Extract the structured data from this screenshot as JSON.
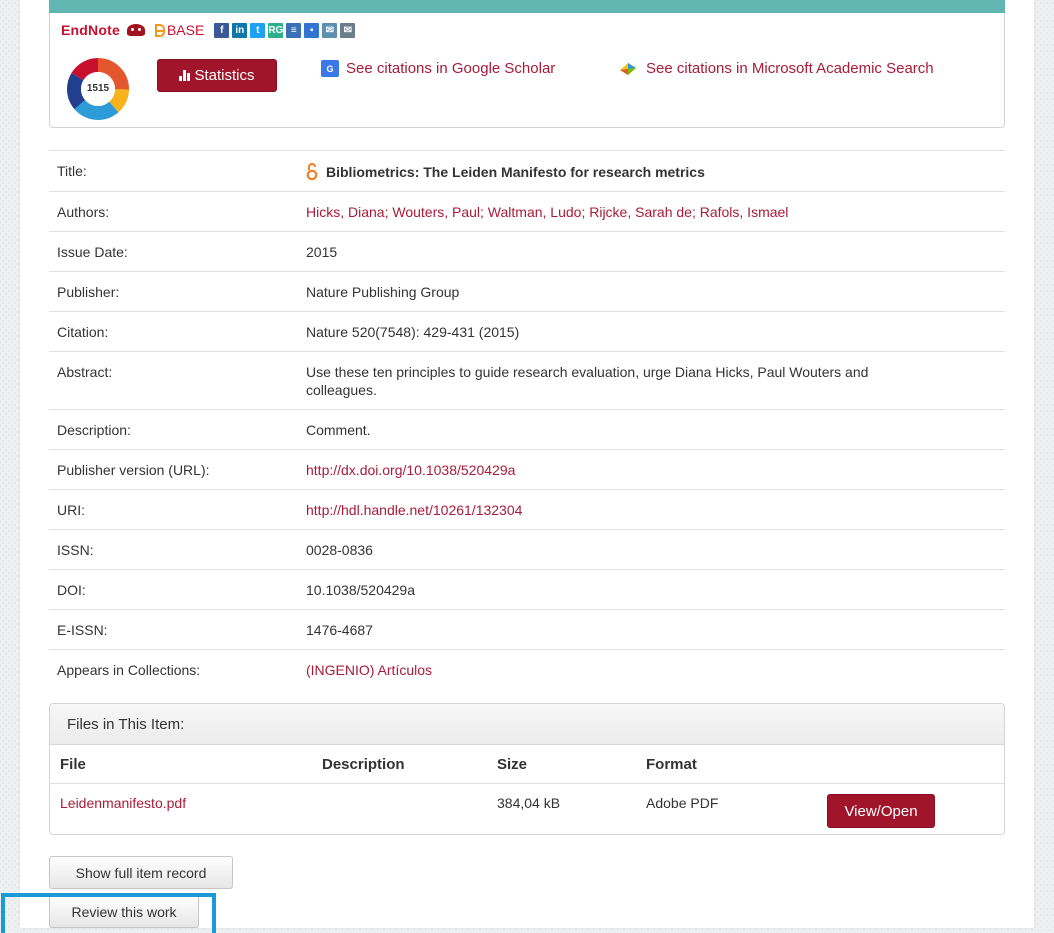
{
  "share": {
    "endnote_label": "EndNote",
    "base_label": "BASE",
    "icons": [
      {
        "name": "facebook-icon",
        "glyph": "f",
        "color": "#3b5998"
      },
      {
        "name": "linkedin-icon",
        "glyph": "in",
        "color": "#0e76a8"
      },
      {
        "name": "twitter-icon",
        "glyph": "t",
        "color": "#1da1f2"
      },
      {
        "name": "researchgate-icon",
        "glyph": "RG",
        "color": "#2ab08d"
      },
      {
        "name": "list-icon",
        "glyph": "≡",
        "color": "#3b6fb6"
      },
      {
        "name": "delicious-icon",
        "glyph": "▪",
        "color": "#3274d0"
      },
      {
        "name": "chat-icon",
        "glyph": "✉",
        "color": "#5d8fb1"
      },
      {
        "name": "email-icon",
        "glyph": "✉",
        "color": "#6a7d8c"
      }
    ]
  },
  "metrics": {
    "altmetric_score": "1515",
    "statistics_label": "Statistics",
    "google_scholar_label": "See citations in Google Scholar",
    "microsoft_label": "See citations in Microsoft Academic Search"
  },
  "record": [
    {
      "label": "Title:",
      "value": "Bibliometrics: The Leiden Manifesto for research metrics",
      "kind": "title"
    },
    {
      "label": "Authors:",
      "value": "Hicks, Diana; Wouters, Paul; Waltman, Ludo; Rijcke, Sarah de; Rafols, Ismael",
      "kind": "link"
    },
    {
      "label": "Issue Date:",
      "value": "2015",
      "kind": "text"
    },
    {
      "label": "Publisher:",
      "value": "Nature Publishing Group",
      "kind": "text"
    },
    {
      "label": "Citation:",
      "value": "Nature 520(7548): 429-431 (2015)",
      "kind": "text"
    },
    {
      "label": "Abstract:",
      "value": "Use these ten principles to guide research evaluation, urge Diana Hicks, Paul Wouters and colleagues.",
      "kind": "text"
    },
    {
      "label": "Description:",
      "value": "Comment.",
      "kind": "text"
    },
    {
      "label": "Publisher version (URL):",
      "value": "http://dx.doi.org/10.1038/520429a",
      "kind": "link"
    },
    {
      "label": "URI:",
      "value": "http://hdl.handle.net/10261/132304",
      "kind": "link"
    },
    {
      "label": "ISSN:",
      "value": "0028-0836",
      "kind": "text"
    },
    {
      "label": "DOI:",
      "value": "10.1038/520429a",
      "kind": "text"
    },
    {
      "label": "E-ISSN:",
      "value": "1476-4687",
      "kind": "text"
    },
    {
      "label": "Appears in Collections:",
      "value": "(INGENIO) Artículos",
      "kind": "link"
    }
  ],
  "files": {
    "heading": "Files in This Item:",
    "columns": {
      "file": "File",
      "description": "Description",
      "size": "Size",
      "format": "Format"
    },
    "rows": [
      {
        "file": "Leidenmanifesto.pdf",
        "description": "",
        "size": "384,04 kB",
        "format": "Adobe PDF",
        "action": "View/Open"
      }
    ]
  },
  "actions": {
    "full_record": "Show full item record",
    "review": "Review this work"
  },
  "colors": {
    "accent": "#a0152a",
    "link": "#a81b3a",
    "teal_bar": "#62b6b2",
    "highlight": "#1a9bd7"
  }
}
